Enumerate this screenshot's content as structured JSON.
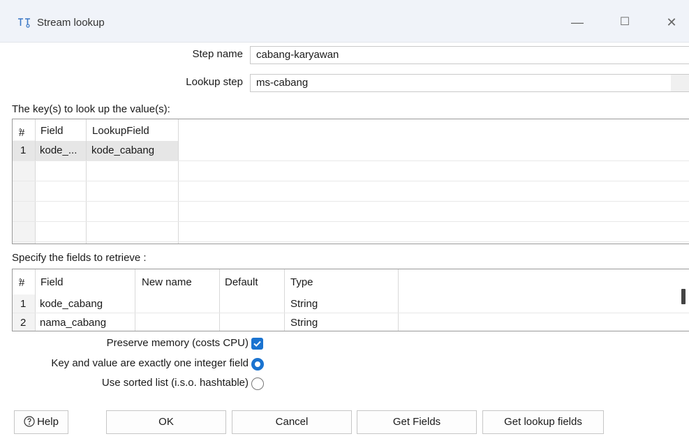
{
  "window": {
    "title": "Stream lookup",
    "minimize": "—",
    "maximize": "☐",
    "close": "✕"
  },
  "form": {
    "step_name_label": "Step name",
    "step_name_value": "cabang-karyawan",
    "lookup_step_label": "Lookup step",
    "lookup_step_value": "ms-cabang"
  },
  "keys_section": {
    "label": "The key(s) to look up the value(s):",
    "columns": [
      "#",
      "Field",
      "LookupField"
    ],
    "rows": [
      {
        "num": "1",
        "field": "kode_...",
        "lookup": "kode_cabang"
      }
    ]
  },
  "fields_section": {
    "label": "Specify the fields to retrieve :",
    "columns": [
      "#",
      "Field",
      "New name",
      "Default",
      "Type"
    ],
    "rows": [
      {
        "num": "1",
        "field": "kode_cabang",
        "new_name": "",
        "default": "",
        "type": "String"
      },
      {
        "num": "2",
        "field": "nama_cabang",
        "new_name": "",
        "default": "",
        "type": "String"
      }
    ]
  },
  "options": {
    "preserve_memory": {
      "label": "Preserve memory (costs CPU)",
      "checked": true
    },
    "one_integer": {
      "label": "Key and value are exactly one integer field",
      "selected": true
    },
    "sorted_list": {
      "label": "Use sorted list (i.s.o. hashtable)",
      "selected": false
    }
  },
  "buttons": {
    "help": "Help",
    "ok": "OK",
    "cancel": "Cancel",
    "get_fields": "Get Fields",
    "get_lookup_fields": "Get lookup fields"
  },
  "colors": {
    "accent": "#1a73d0",
    "titlebar": "#f0f3f9",
    "row_selected": "#e6e6e6"
  }
}
